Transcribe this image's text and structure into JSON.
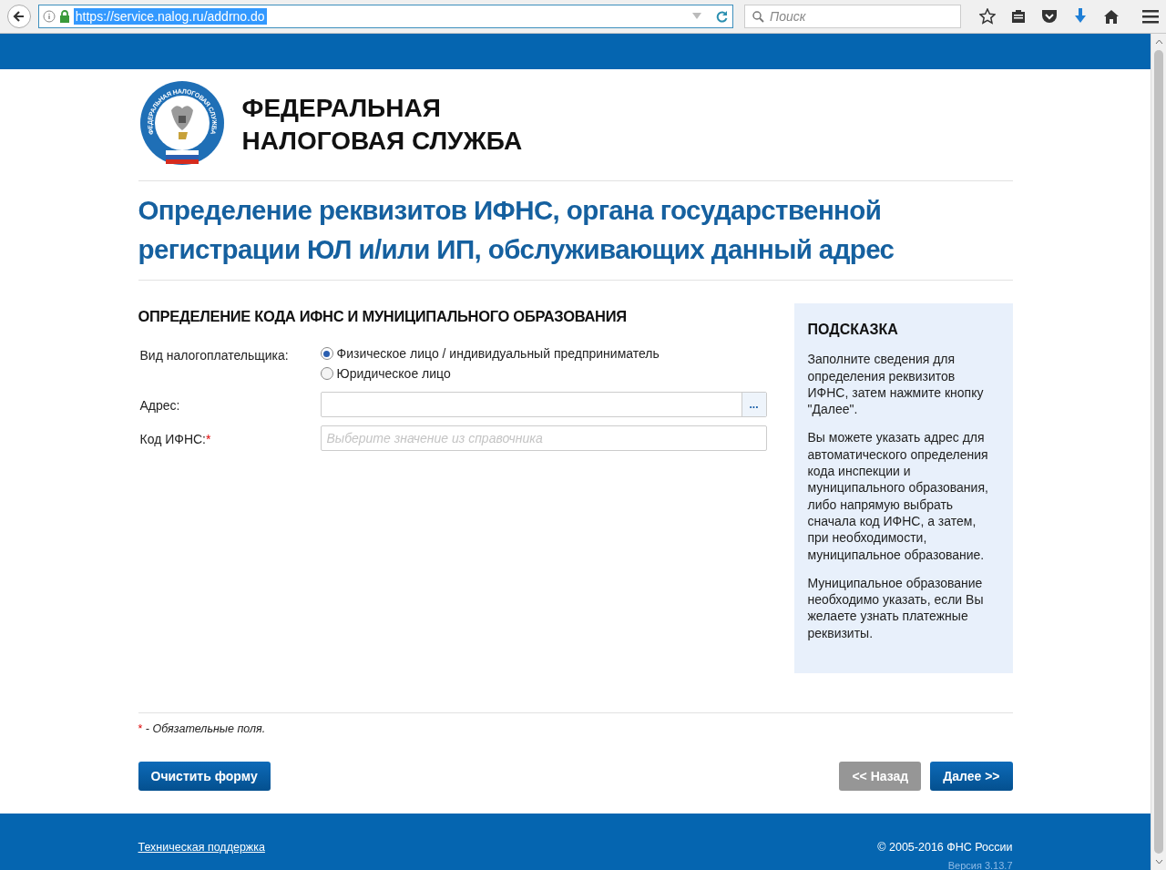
{
  "browser": {
    "url": "https://service.nalog.ru/addrno.do",
    "search_placeholder": "Поиск"
  },
  "logo": {
    "ring_text": "ФЕДЕРАЛЬНАЯ НАЛОГОВАЯ СЛУЖБА",
    "title_lines": [
      "ФЕДЕРАЛЬНАЯ",
      "НАЛОГОВАЯ СЛУЖБА"
    ]
  },
  "page_title": "Определение реквизитов ИФНС, органа государственной регистрации ЮЛ и/или ИП, обслуживающих данный адрес",
  "form": {
    "heading": "ОПРЕДЕЛЕНИЕ КОДА ИФНС И МУНИЦИПАЛЬНОГО ОБРАЗОВАНИЯ",
    "taxpayer_label": "Вид налогоплательщика:",
    "taxpayer_options": [
      {
        "label": "Физическое лицо / индивидуальный предприниматель",
        "selected": true
      },
      {
        "label": "Юридическое лицо",
        "selected": false
      }
    ],
    "address": {
      "label": "Адрес:",
      "button": "..."
    },
    "ifns_code": {
      "label": "Код ИФНС:",
      "required": true,
      "placeholder": "Выберите значение из справочника"
    }
  },
  "hint": {
    "title": "ПОДСКАЗКА",
    "paragraphs": [
      "Заполните сведения для определения реквизитов ИФНС, затем нажмите кнопку \"Далее\".",
      "Вы можете указать адрес для автоматического определения кода инспекции и муниципального образования, либо напрямую выбрать сначала код ИФНС, а затем, при необходимости, муниципальное образование.",
      "Муниципальное образование необходимо указать, если Вы желаете узнать платежные реквизиты."
    ]
  },
  "required_note": {
    "mark": "*",
    "text": "- Обязательные поля."
  },
  "buttons": [
    {
      "label": "Очистить форму",
      "disabled": false
    },
    {
      "label": "<< Назад",
      "disabled": true
    },
    {
      "label": "Далее >>",
      "disabled": false
    }
  ],
  "footer": {
    "link": "Техническая поддержка",
    "copyright": "© 2005-2016 ФНС России",
    "version": "Версия 3.13.7"
  }
}
